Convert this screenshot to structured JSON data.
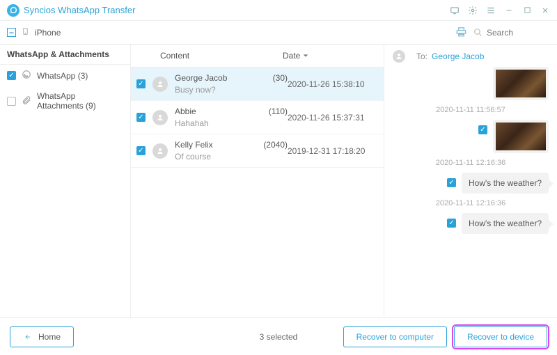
{
  "app": {
    "title": "Syncios WhatsApp Transfer"
  },
  "toolbar": {
    "device": "iPhone",
    "search_placeholder": "Search"
  },
  "sidebar": {
    "header": "WhatsApp & Attachments",
    "items": [
      {
        "label": "WhatsApp (3)",
        "checked": true,
        "icon": "whatsapp"
      },
      {
        "label": "WhatsApp Attachments (9)",
        "checked": false,
        "icon": "attachment"
      }
    ]
  },
  "table": {
    "cols": {
      "content": "Content",
      "date": "Date"
    },
    "rows": [
      {
        "name": "George Jacob",
        "count": "(30)",
        "preview": "Busy now?",
        "date": "2020-11-26 15:38:10",
        "checked": true,
        "selected": true
      },
      {
        "name": "Abbie",
        "count": "(110)",
        "preview": "Hahahah",
        "date": "2020-11-26 15:37:31",
        "checked": true,
        "selected": false
      },
      {
        "name": "Kelly Felix",
        "count": "(2040)",
        "preview": "Of course",
        "date": "2019-12-31 17:18:20",
        "checked": true,
        "selected": false
      }
    ]
  },
  "preview": {
    "to_label": "To:",
    "to_name": "George Jacob",
    "messages": [
      {
        "ts": "",
        "type": "image",
        "checked": false,
        "show_cb": false
      },
      {
        "ts": "2020-11-11 11:56:57",
        "type": "image",
        "checked": true,
        "show_cb": true
      },
      {
        "ts": "2020-11-11 12:16:36",
        "type": "text",
        "text": "How's the weather?",
        "checked": true,
        "show_cb": true
      },
      {
        "ts": "2020-11-11 12:16:36",
        "type": "text",
        "text": "How's the weather?",
        "checked": true,
        "show_cb": true
      }
    ]
  },
  "footer": {
    "home": "Home",
    "selected": "3 selected",
    "recover_computer": "Recover to computer",
    "recover_device": "Recover to device"
  }
}
